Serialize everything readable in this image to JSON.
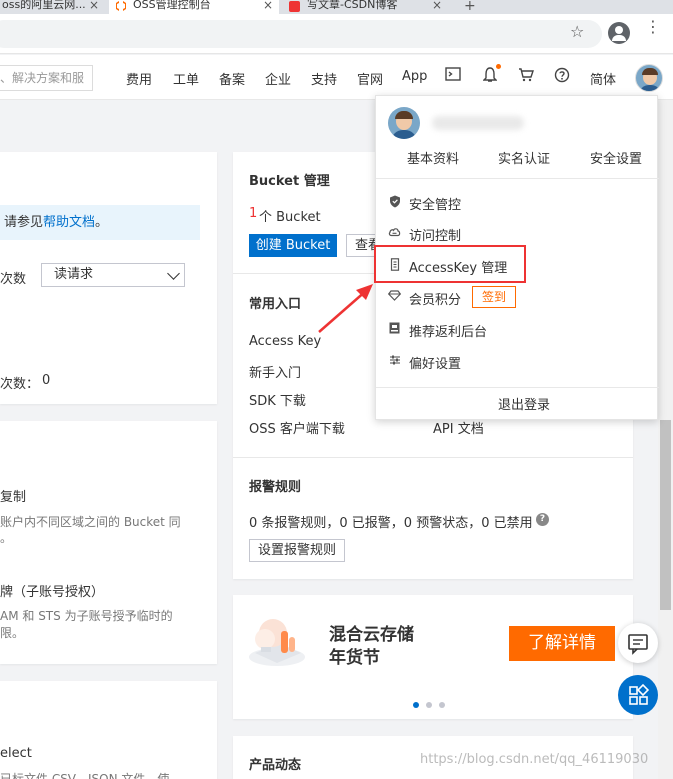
{
  "browser": {
    "tabs": [
      {
        "label": "oss的阿里云网...",
        "close": "×"
      },
      {
        "label": "OSS管理控制台",
        "close": "×"
      },
      {
        "label": "写文章-CSDN博客",
        "close": "×"
      }
    ],
    "new_tab": "+"
  },
  "topnav": {
    "search_placeholder": "、解决方案和服",
    "items": [
      "费用",
      "工单",
      "备案",
      "企业",
      "支持",
      "官网",
      "App",
      "简体"
    ]
  },
  "left": {
    "info_text": "请参见",
    "info_link": "帮助文档",
    "info_tail": "。",
    "label1": "次数",
    "select_value": "读请求",
    "label2": "次数：",
    "label2_value": "0",
    "section2_title": "复制",
    "section2_desc1": "账户内不同区域之间的 Bucket 同",
    "section2_desc2": "。",
    "section3_title": "牌（子账号授权）",
    "section3_desc1": "AM 和 STS 为子账号授予临时的",
    "section3_desc2": "限。",
    "section4_title": "elect",
    "section4_desc": "已标文件 CSV、JSON 文件，使"
  },
  "bucket": {
    "title": "Bucket 管理",
    "count": "1",
    "count_unit": "个 Bucket",
    "create_btn": "创建 Bucket",
    "view_btn": "查看"
  },
  "entry": {
    "title": "常用入口",
    "items": [
      "Access Key",
      "新手入门",
      "SDK 下载",
      "OSS 客户端下载"
    ],
    "right_item": "API 文档"
  },
  "alarm": {
    "title": "报警规则",
    "summary": "0 条报警规则，0 已报警，0 预警状态，0 已禁用",
    "button": "设置报警规则"
  },
  "banner": {
    "line1": "混合云存储",
    "line2": "年货节",
    "button": "了解详情"
  },
  "product_news": {
    "title": "产品动态"
  },
  "dropdown": {
    "tabs": [
      "基本资料",
      "实名认证",
      "安全设置"
    ],
    "items": [
      {
        "label": "安全管控",
        "icon": "shield-icon"
      },
      {
        "label": "访问控制",
        "icon": "cloud-icon"
      },
      {
        "label": "AccessKey 管理",
        "icon": "key-icon"
      },
      {
        "label": "会员积分",
        "icon": "diamond-icon"
      },
      {
        "label": "推荐返利后台",
        "icon": "gift-icon"
      },
      {
        "label": "偏好设置",
        "icon": "sliders-icon"
      }
    ],
    "signin": "签到",
    "logout": "退出登录"
  },
  "watermark": "https://blog.csdn.net/qq_46119030",
  "colors": {
    "primary": "#0070cc",
    "accent": "#ff6a00",
    "highlight": "#e33333"
  }
}
